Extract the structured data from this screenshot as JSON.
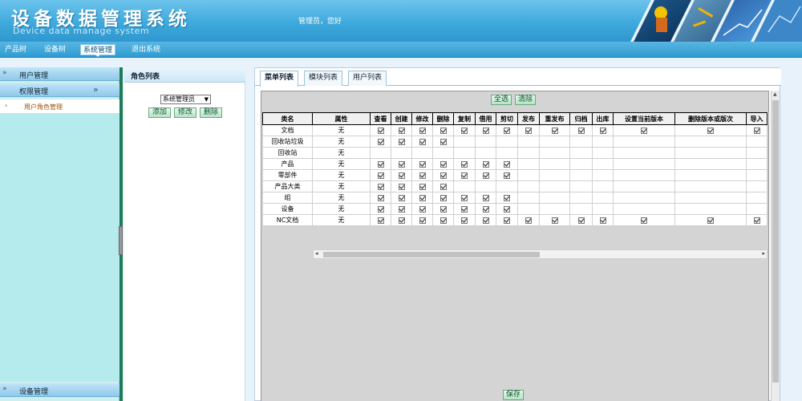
{
  "header": {
    "title": "设备数据管理系统",
    "subtitle": "Device data manage system",
    "admin_greeting": "管理员，您好"
  },
  "nav": {
    "items": [
      {
        "label": "产品树"
      },
      {
        "label": "设备树"
      },
      {
        "label": "系统管理",
        "active": true
      },
      {
        "label": "退出系统"
      }
    ]
  },
  "sidebar": {
    "user_mgmt": "用户管理",
    "perm_mgmt": "权限管理",
    "user_role_mgmt": "用户角色管理",
    "device_mgmt": "设备管理"
  },
  "role_panel": {
    "title": "角色列表",
    "selected_role": "系统管理员",
    "add_label": "添加",
    "edit_label": "修改",
    "delete_label": "删除"
  },
  "main": {
    "tabs": [
      {
        "label": "菜单列表",
        "active": true
      },
      {
        "label": "模块列表"
      },
      {
        "label": "用户列表"
      }
    ],
    "select_all_label": "全选",
    "clear_label": "清除",
    "save_label": "保存",
    "table": {
      "columns": [
        "类名",
        "属性",
        "查看",
        "创建",
        "修改",
        "删除",
        "复制",
        "借用",
        "剪切",
        "发布",
        "重发布",
        "归档",
        "出库",
        "设置当前版本",
        "删除版本或版次",
        "导入"
      ],
      "rows": [
        {
          "name": "文档",
          "attr": "无",
          "checks": [
            1,
            1,
            1,
            1,
            1,
            1,
            1,
            1,
            1,
            1,
            1,
            1,
            1,
            1
          ]
        },
        {
          "name": "回收站垃圾",
          "attr": "无",
          "checks": [
            1,
            1,
            1,
            1,
            0,
            0,
            0,
            0,
            0,
            0,
            0,
            0,
            0,
            0
          ]
        },
        {
          "name": "回收站",
          "attr": "无",
          "checks": [
            0,
            0,
            0,
            0,
            0,
            0,
            0,
            0,
            0,
            0,
            0,
            0,
            0,
            0
          ]
        },
        {
          "name": "产品",
          "attr": "无",
          "checks": [
            1,
            1,
            1,
            1,
            1,
            1,
            1,
            0,
            0,
            0,
            0,
            0,
            0,
            0
          ]
        },
        {
          "name": "零部件",
          "attr": "无",
          "checks": [
            1,
            1,
            1,
            1,
            1,
            1,
            1,
            0,
            0,
            0,
            0,
            0,
            0,
            0
          ]
        },
        {
          "name": "产品大类",
          "attr": "无",
          "checks": [
            1,
            1,
            1,
            1,
            0,
            0,
            0,
            0,
            0,
            0,
            0,
            0,
            0,
            0
          ]
        },
        {
          "name": "组",
          "attr": "无",
          "checks": [
            1,
            1,
            1,
            1,
            1,
            1,
            1,
            0,
            0,
            0,
            0,
            0,
            0,
            0
          ]
        },
        {
          "name": "设备",
          "attr": "无",
          "checks": [
            1,
            1,
            1,
            1,
            1,
            1,
            1,
            0,
            0,
            0,
            0,
            0,
            0,
            0
          ]
        },
        {
          "name": "NC文档",
          "attr": "无",
          "checks": [
            1,
            1,
            1,
            1,
            1,
            1,
            1,
            1,
            1,
            1,
            1,
            1,
            1,
            1
          ]
        }
      ]
    }
  },
  "colors": {
    "header_blue": "#3ea9dc",
    "sidebar_teal": "#b5ebec",
    "splitter_green": "#1e7b56",
    "button_green": "#b6e3c6"
  }
}
